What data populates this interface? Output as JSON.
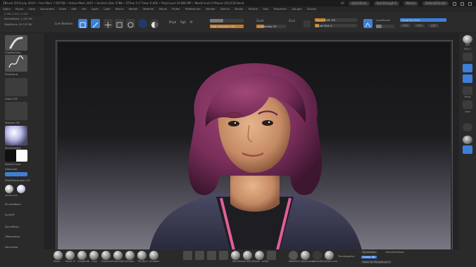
{
  "titlebar": {
    "text": "ZBrush 2019  July 2019  • Free Mem 7.607GB  • Active Mem 3267  • Scratch Disk 5788  • ZTime 5.4  Timer 0.002  • PolyCount 19.869 MP  • MeshCount 9  Mouse 254,616 Bend",
    "ac": "AC",
    "quicksave": "QuickSave",
    "see_through": "See-through 0",
    "menus_btn": "Menus",
    "default_zscript": "DefaultZScript"
  },
  "menubar": {
    "items": [
      "Alpha",
      "Brush",
      "Color",
      "Document",
      "Draw",
      "Edit",
      "File",
      "Layer",
      "Light",
      "Macro",
      "Marker",
      "Material",
      "Movie",
      "Picker",
      "Preferences",
      "Render",
      "Stencil",
      "Stroke",
      "Texture",
      "Tool",
      "Transform",
      "Zplugin",
      "Zscript"
    ]
  },
  "infoline": "0.381,0.613,-0.184",
  "left": {
    "active_points": "ActivePoints: 1.232 Mil",
    "total_points": "TotalPoints: 20.747 Mil",
    "brush": "ClayBuildup",
    "stroke": "FreeHand",
    "alpha": "Alpha Off",
    "texture": "Texture Off",
    "material": "SkinShade4",
    "gradient": "Gradient",
    "switch_color": "SwitchColor",
    "alternate": "Alternate",
    "fill_object": "FillObject",
    "ss": "SSelSharpness 0.9",
    "mat1": "SkinShade4",
    "mat2": "SkinShade4",
    "dynamesh": "DynaMesh",
    "zremesher": "ZRemesher",
    "decimate": "Decimate",
    "symmetry": "SymMT",
    "pinned": "PinnedMesh"
  },
  "toolbar": {
    "live_boolean": "Live Boolean",
    "edit": "Edit",
    "draw": "Draw",
    "move": "Move",
    "scale": "Scale",
    "rotate": "Rotate",
    "mrgb": "Mrgb",
    "rgb": "Rgb",
    "m": "M",
    "zadd": "Zadd",
    "zsub": "Zsub",
    "zcut": "Zcut",
    "rgb_intensity": "Rgb Intensity 100",
    "z_intensity": "Z Intensity 25",
    "focal_shift": "Focal Shift -50",
    "draw_size": "Draw Size 1",
    "dynamic": "Dynamic",
    "lazymouse": "LazyMouse",
    "lazystep": "LazyStep",
    "lazysmooth": "LazySmooth",
    "right_btn": "Weighted Blur",
    "x1": "<X>",
    "x2": "<Y>",
    "x3": "<Z>"
  },
  "right": {
    "bpr": "BPR",
    "spix": "SPix 3",
    "scroll": "Scroll",
    "zoom": "Zoom",
    "actual": "Actual",
    "aahalf": "AAHalf",
    "persp": "Persp",
    "floor": "Floor",
    "local": "Local",
    "frame": "Frame",
    "move": "Move",
    "zoom3d": "Zoom3D",
    "rotate": "Rotate",
    "polyf": "PolyF",
    "transp": "Transp"
  },
  "bottom": {
    "brushes": [
      "Move",
      "Move Tr",
      "ClayBuild",
      "Clay",
      "Standard",
      "DamStan",
      "hPolish",
      "TrimDyn",
      "Smooth"
    ],
    "mid": [
      "SkinShade",
      "SkinShade",
      "Inflat",
      "MatCap",
      "BasicMat",
      "BasicMat",
      "InsertSph"
    ],
    "right1": [
      "MaskPen",
      "MaskLasso",
      "SelectRect",
      "ClipCurve"
    ],
    "right2": "TrimAdaptive",
    "sym": "Symmetry",
    "gizmo": "Gizmo 3D",
    "backface": "BackfaceMask",
    "mask_poly": "Mask By Polygroups 0"
  },
  "colors": {
    "accent_blue": "#3e7fd6",
    "orange_slider": "#c87a22"
  }
}
